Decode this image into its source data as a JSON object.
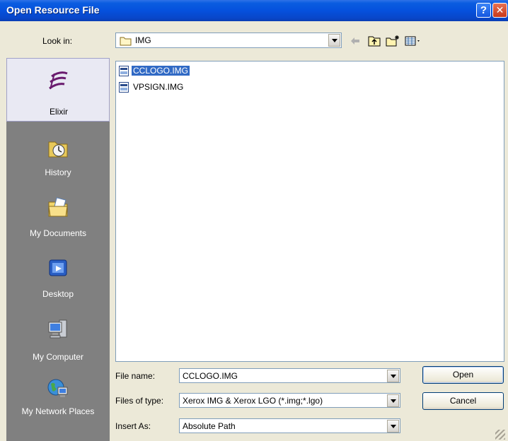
{
  "window": {
    "title": "Open Resource File"
  },
  "lookin": {
    "label": "Look in:",
    "value": "IMG"
  },
  "places": [
    {
      "label": "Elixir",
      "icon": "elixir-logo-icon"
    },
    {
      "label": "History",
      "icon": "history-icon"
    },
    {
      "label": "My Documents",
      "icon": "my-documents-icon"
    },
    {
      "label": "Desktop",
      "icon": "desktop-icon"
    },
    {
      "label": "My Computer",
      "icon": "my-computer-icon"
    },
    {
      "label": "My Network Places",
      "icon": "network-places-icon"
    }
  ],
  "files": [
    {
      "name": "CCLOGO.IMG",
      "selected": true
    },
    {
      "name": "VPSIGN.IMG",
      "selected": false
    }
  ],
  "filename": {
    "label": "File name:",
    "value": "CCLOGO.IMG"
  },
  "filetype": {
    "label": "Files of type:",
    "value": "Xerox IMG & Xerox LGO (*.img;*.lgo)"
  },
  "insertas": {
    "label": "Insert As:",
    "value": "Absolute Path"
  },
  "buttons": {
    "open": "Open",
    "cancel": "Cancel"
  },
  "colors": {
    "titlebar": "#0551dd",
    "selection": "#316ac5",
    "places_bg": "#808080",
    "dialog_bg": "#ece9d8"
  }
}
